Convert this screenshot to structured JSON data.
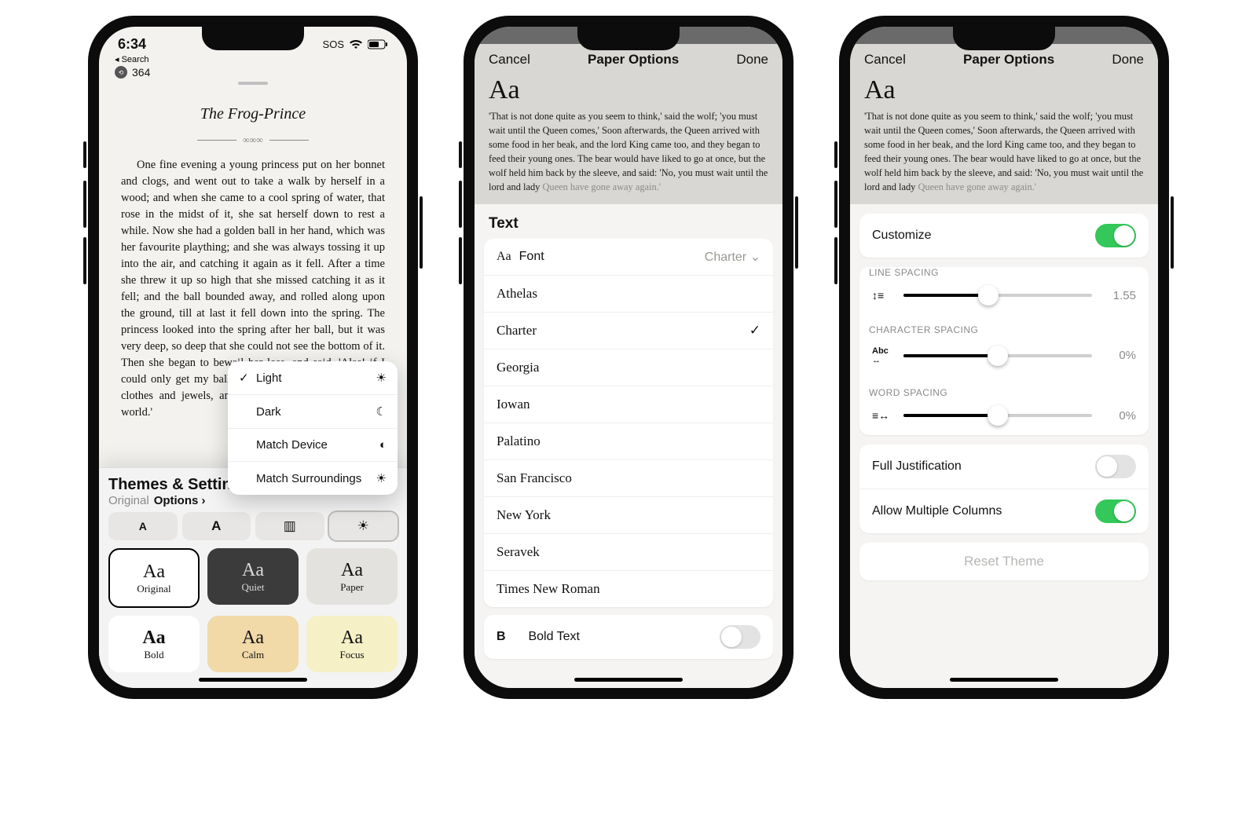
{
  "phone1": {
    "status": {
      "time": "6:34",
      "sos": "SOS"
    },
    "back_label": "Search",
    "page_count": "364",
    "book": {
      "title": "The Frog-Prince",
      "body": "One fine evening a young princess put on her bonnet and clogs, and went out to take a walk by herself in a wood; and when she came to a cool spring of water, that rose in the midst of it, she sat herself down to rest a while. Now she had a golden ball in her hand, which was her favourite plaything; and she was always tossing it up into the air, and catching it again as it fell. After a time she threw it up so high that she missed catching it as it fell; and the ball bounded away, and rolled along upon the ground, till at last it fell down into the spring. The princess looked into the spring after her ball, but it was very deep, so deep that she could not see the bottom of it. Then she began to bewail her loss, and said, 'Alas! if I could only get my ball again, I would give all my fine clothes and jewels, and everything that I have in the world.'"
    },
    "themes": {
      "header": "Themes & Settings",
      "original": "Original",
      "options": "Options",
      "tab_a": "A",
      "tab_b": "A",
      "cards": {
        "original": "Original",
        "quiet": "Quiet",
        "paper": "Paper",
        "bold": "Bold",
        "calm": "Calm",
        "focus": "Focus",
        "aa": "Aa"
      }
    },
    "appearance_menu": {
      "light": "Light",
      "dark": "Dark",
      "match_device": "Match Device",
      "match_surroundings": "Match Surroundings"
    }
  },
  "phone2": {
    "nav": {
      "cancel": "Cancel",
      "title": "Paper Options",
      "done": "Done"
    },
    "sample_aa": "Aa",
    "sample_body_main": "'That is not done quite as you seem to think,' said the wolf; 'you must wait until the Queen comes,' Soon afterwards, the Queen arrived with some food in her beak, and the lord King came too, and they began to feed their young ones. The bear would have liked to go at once, but the wolf held him back by the sleeve, and said: 'No, you must wait until the lord and lady ",
    "sample_body_faded": "Queen have gone away again.'",
    "section": "Text",
    "font_row": {
      "label": "Font",
      "value": "Charter"
    },
    "fonts": [
      "Athelas",
      "Charter",
      "Georgia",
      "Iowan",
      "Palatino",
      "San Francisco",
      "New York",
      "Seravek",
      "Times New Roman"
    ],
    "selected_font": "Charter",
    "bold_text": "Bold Text"
  },
  "phone3": {
    "nav": {
      "cancel": "Cancel",
      "title": "Paper Options",
      "done": "Done"
    },
    "sample_aa": "Aa",
    "sample_body_main": "'That is not done quite as you seem to think,' said the wolf; 'you must wait until the Queen comes,' Soon afterwards, the Queen arrived with some food in her beak, and the lord King came too, and they began to feed their young ones. The bear would have liked to go at once, but the wolf held him back by the sleeve, and said: 'No, you must wait until the lord and lady ",
    "sample_body_faded": "Queen have gone away again.'",
    "customize": "Customize",
    "line_spacing": {
      "label": "LINE SPACING",
      "value": "1.55",
      "pct": 45
    },
    "char_spacing": {
      "label": "CHARACTER SPACING",
      "value": "0%",
      "pct": 50
    },
    "word_spacing": {
      "label": "WORD SPACING",
      "value": "0%",
      "pct": 50
    },
    "full_justification": "Full Justification",
    "allow_columns": "Allow Multiple Columns",
    "reset": "Reset Theme"
  }
}
